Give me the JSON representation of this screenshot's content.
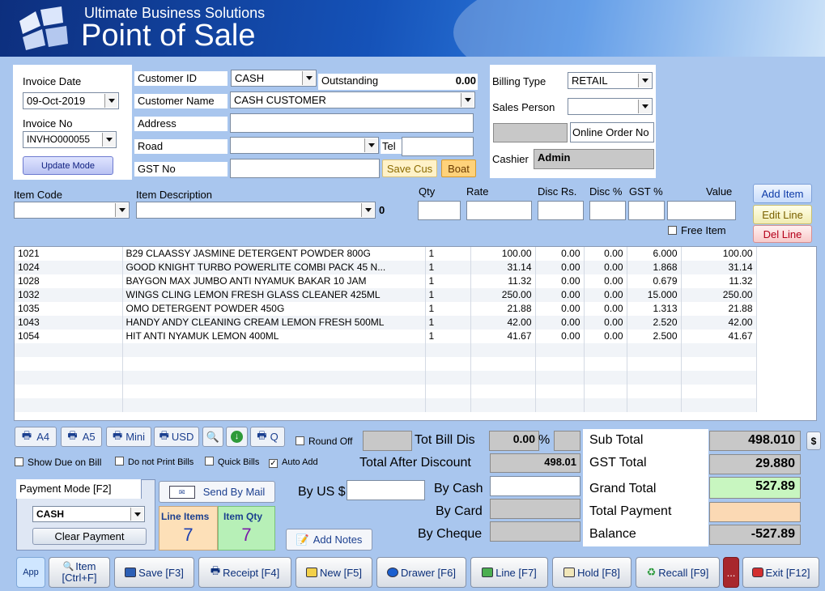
{
  "header": {
    "company": "Ultimate Business Solutions",
    "title": "Point of Sale"
  },
  "invoice": {
    "date_label": "Invoice Date",
    "date_value": "09-Oct-2019",
    "no_label": "Invoice No",
    "no_value": "INVHO000055",
    "update_mode": "Update Mode"
  },
  "customer": {
    "id_label": "Customer ID",
    "id_value": "CASH",
    "outstanding_label": "Outstanding",
    "outstanding_value": "0.00",
    "name_label": "Customer  Name",
    "name_value": "CASH CUSTOMER",
    "address_label": "Address",
    "road_label": "Road",
    "tel_label": "Tel",
    "gst_label": "GST No",
    "save_cus": "Save Cus",
    "boat": "Boat"
  },
  "billing": {
    "type_label": "Billing Type",
    "type_value": "RETAIL",
    "sales_label": "Sales Person",
    "online_order": "Online Order No",
    "cashier_label": "Cashier",
    "cashier_value": "Admin"
  },
  "entry": {
    "item_code": "Item Code",
    "item_desc": "Item Description",
    "zero": "0",
    "qty": "Qty",
    "rate": "Rate",
    "disc_rs": "Disc Rs.",
    "disc_pct": "Disc %",
    "gst_pct": "GST %",
    "value": "Value",
    "free_item": "Free Item",
    "add_item": "Add Item",
    "edit_line": "Edit Line",
    "del_line": "Del Line"
  },
  "items": [
    [
      "1021",
      "B29 CLAASSY JASMINE DETERGENT POWDER 800G",
      "1",
      "100.00",
      "0.00",
      "0.00",
      "6.000",
      "100.00"
    ],
    [
      "1024",
      "GOOD KNIGHT TURBO POWERLITE COMBI PACK 45 N...",
      "1",
      "31.14",
      "0.00",
      "0.00",
      "1.868",
      "31.14"
    ],
    [
      "1028",
      "BAYGON MAX JUMBO ANTI NYAMUK BAKAR 10 JAM",
      "1",
      "11.32",
      "0.00",
      "0.00",
      "0.679",
      "11.32"
    ],
    [
      "1032",
      "WINGS CLING LEMON FRESH GLASS CLEANER 425ML",
      "1",
      "250.00",
      "0.00",
      "0.00",
      "15.000",
      "250.00"
    ],
    [
      "1035",
      "OMO DETERGENT POWDER 450G",
      "1",
      "21.88",
      "0.00",
      "0.00",
      "1.313",
      "21.88"
    ],
    [
      "1043",
      "HANDY ANDY CLEANING CREAM LEMON FRESH 500ML",
      "1",
      "42.00",
      "0.00",
      "0.00",
      "2.520",
      "42.00"
    ],
    [
      "1054",
      "HIT ANTI NYAMUK LEMON 400ML",
      "1",
      "41.67",
      "0.00",
      "0.00",
      "2.500",
      "41.67"
    ]
  ],
  "print": {
    "a4": "A4",
    "a5": "A5",
    "mini": "Mini",
    "usd": "USD",
    "q": "Q"
  },
  "options": {
    "show_due": "Show Due on Bill",
    "no_print": "Do not Print Bills",
    "quick_bills": "Quick Bills",
    "auto_add": "Auto Add",
    "round_off": "Round Off"
  },
  "payment": {
    "mode_label": "Payment Mode [F2]",
    "mode_value": "CASH",
    "clear": "Clear Payment",
    "send_mail": "Send By Mail",
    "line_items_label": "Line Items",
    "line_items_value": "7",
    "item_qty_label": "Item Qty",
    "item_qty_value": "7",
    "add_notes": "Add  Notes",
    "by_us": "By US $",
    "by_cash": "By Cash",
    "by_card": "By Card",
    "by_cheque": "By Cheque"
  },
  "discount": {
    "tot_bill_dis": "Tot Bill Dis",
    "tot_bill_dis_value": "0.00",
    "pct": "%",
    "after_discount_label": "Total After Discount",
    "after_discount_value": "498.01"
  },
  "totals": {
    "sub_total_label": "Sub Total",
    "sub_total": "498.010",
    "dollar": "$",
    "gst_total_label": "GST Total",
    "gst_total": "29.880",
    "grand_total_label": "Grand Total",
    "grand_total": "527.89",
    "total_payment_label": "Total Payment",
    "total_payment": "",
    "balance_label": "Balance",
    "balance": "-527.89"
  },
  "toolbar": {
    "app": "App",
    "item": "Item",
    "item2": "[Ctrl+F]",
    "save": "Save [F3]",
    "receipt": "Receipt [F4]",
    "new": "New [F5]",
    "drawer": "Drawer [F6]",
    "line": "Line [F7]",
    "hold": "Hold [F8]",
    "recall": "Recall [F9]",
    "more": "...",
    "exit": "Exit [F12]"
  }
}
